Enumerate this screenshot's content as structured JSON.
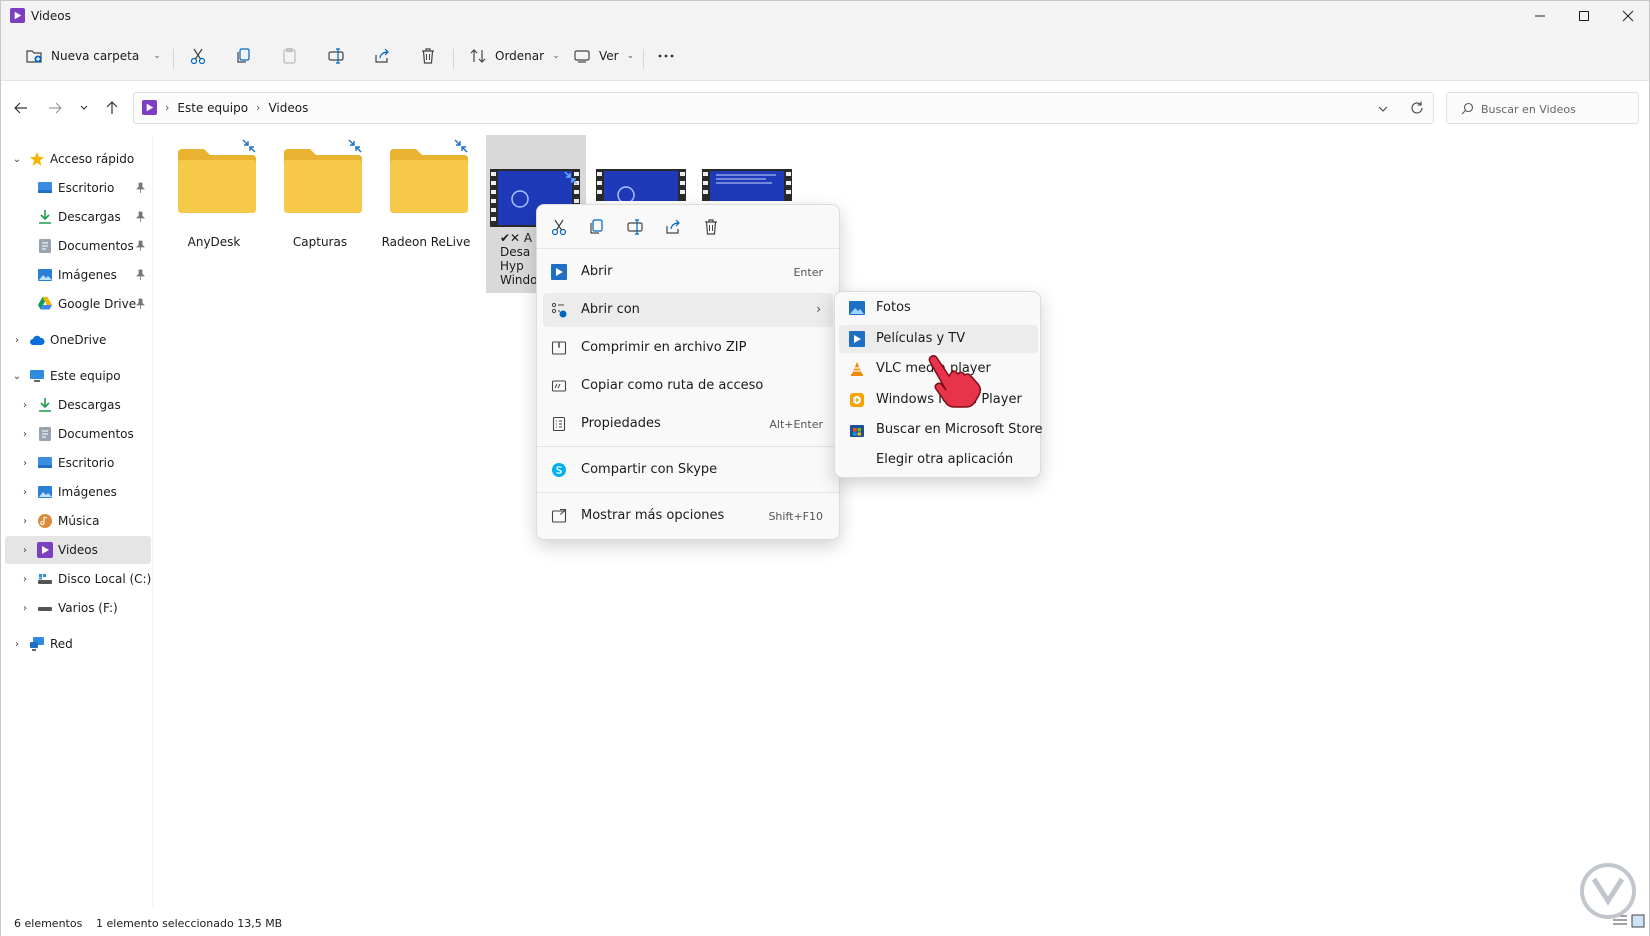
{
  "window": {
    "title": "Videos"
  },
  "toolbar": {
    "new_folder_label": "Nueva carpeta",
    "sort_label": "Ordenar",
    "view_label": "Ver"
  },
  "address": {
    "crumbs": [
      "Este equipo",
      "Videos"
    ],
    "search_placeholder": "Buscar en Videos"
  },
  "sidebar": {
    "quick_access": "Acceso rápido",
    "quick_items": [
      "Escritorio",
      "Descargas",
      "Documentos",
      "Imágenes",
      "Google Drive"
    ],
    "onedrive": "OneDrive",
    "this_pc": "Este equipo",
    "pc_items": [
      "Descargas",
      "Documentos",
      "Escritorio",
      "Imágenes",
      "Música",
      "Videos",
      "Disco Local (C:)",
      "Varios (F:)"
    ],
    "network": "Red"
  },
  "files": [
    {
      "name": "AnyDesk",
      "type": "folder"
    },
    {
      "name": "Capturas",
      "type": "folder"
    },
    {
      "name": "Radeon ReLive",
      "type": "folder"
    },
    {
      "name": "✔✕ A\nDesa\nHyp\nWindow",
      "type": "video"
    },
    {
      "name": "",
      "type": "video"
    },
    {
      "name": "",
      "type": "video"
    }
  ],
  "context_menu": {
    "items": [
      {
        "label": "Abrir",
        "shortcut": "Enter"
      },
      {
        "label": "Abrir con",
        "shortcut": ""
      },
      {
        "label": "Comprimir en archivo ZIP",
        "shortcut": ""
      },
      {
        "label": "Copiar como ruta de acceso",
        "shortcut": ""
      },
      {
        "label": "Propiedades",
        "shortcut": "Alt+Enter"
      },
      {
        "label": "Compartir con Skype",
        "shortcut": ""
      },
      {
        "label": "Mostrar más opciones",
        "shortcut": "Shift+F10"
      }
    ]
  },
  "open_with_menu": {
    "items": [
      "Fotos",
      "Películas y TV",
      "VLC media player",
      "Windows Media Player",
      "Buscar en Microsoft Store",
      "Elegir otra aplicación"
    ]
  },
  "status": {
    "count": "6 elementos",
    "selection": "1 elemento seleccionado  13,5 MB"
  },
  "colors": {
    "accent": "#0067c0",
    "folder": "#f7c948",
    "video_thumb": "#1e3ab8",
    "cursor": "#e8344a"
  }
}
